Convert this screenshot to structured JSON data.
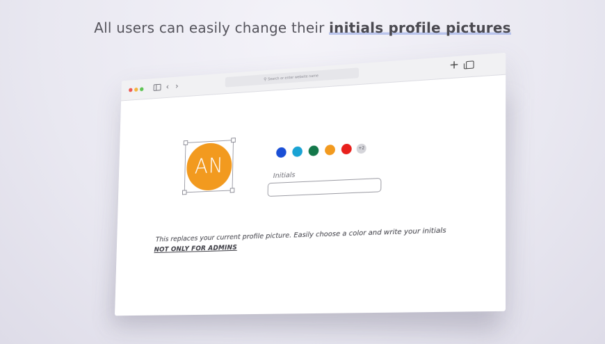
{
  "headline": {
    "prefix": "All users can easily change their ",
    "highlight": "initials profile pictures"
  },
  "browser": {
    "url_placeholder": "Search or enter website name",
    "icons": [
      "sidebar-icon",
      "chevron-left-icon",
      "chevron-right-icon",
      "search-icon",
      "plus-icon",
      "tabs-icon"
    ]
  },
  "avatar": {
    "initials": "AN",
    "color": "#f29a1f"
  },
  "colors": {
    "swatches": [
      "#1a4fd6",
      "#1aa3d4",
      "#14784a",
      "#f29a1f",
      "#e8201c"
    ],
    "more_label": "+2"
  },
  "initials_field": {
    "label": "Initials",
    "value": ""
  },
  "description": "This replaces your current profile picture. Easily choose a color and write your initials",
  "admins_note": "NOT ONLY FOR ADMINS"
}
